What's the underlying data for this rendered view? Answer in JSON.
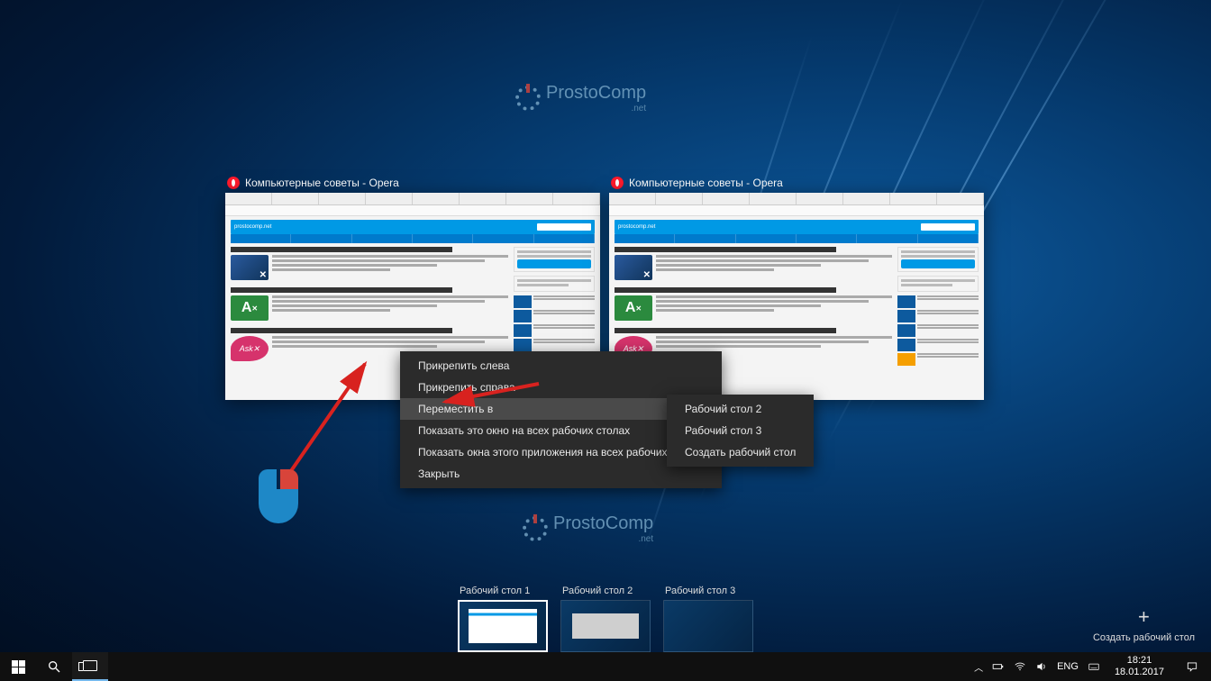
{
  "watermark": {
    "name": "ProstoComp",
    "suffix": ".net"
  },
  "windows": [
    {
      "title": "Компьютерные советы - Opera",
      "site": "prostocomp.net"
    },
    {
      "title": "Компьютерные советы - Opera",
      "site": "prostocomp.net"
    }
  ],
  "context_menu": {
    "items": [
      {
        "label": "Прикрепить слева"
      },
      {
        "label": "Прикрепить справа"
      },
      {
        "label": "Переместить в",
        "submenu": true,
        "hover": true
      },
      {
        "label": "Показать это окно на всех рабочих столах"
      },
      {
        "label": "Показать окна этого приложения на всех рабочих столах"
      },
      {
        "label": "Закрыть"
      }
    ],
    "submenu": [
      {
        "label": "Рабочий стол 2"
      },
      {
        "label": "Рабочий стол 3"
      },
      {
        "label": "Создать рабочий стол"
      }
    ]
  },
  "desktops": [
    {
      "label": "Рабочий стол 1",
      "active": true
    },
    {
      "label": "Рабочий стол 2"
    },
    {
      "label": "Рабочий стол 3"
    }
  ],
  "new_desktop_label": "Создать рабочий стол",
  "tray": {
    "lang": "ENG",
    "time": "18:21",
    "date": "18.01.2017"
  }
}
